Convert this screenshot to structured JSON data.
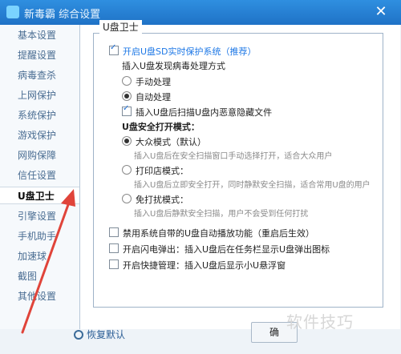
{
  "window": {
    "title": "新毒霸 综合设置",
    "close": "✕"
  },
  "sidebar": {
    "items": [
      {
        "label": "基本设置",
        "active": false
      },
      {
        "label": "提醒设置",
        "active": false
      },
      {
        "label": "病毒查杀",
        "active": false
      },
      {
        "label": "上网保护",
        "active": false
      },
      {
        "label": "系统保护",
        "active": false
      },
      {
        "label": "游戏保护",
        "active": false
      },
      {
        "label": "网购保障",
        "active": false
      },
      {
        "label": "信任设置",
        "active": false
      },
      {
        "label": "U盘卫士",
        "active": true
      },
      {
        "label": "引擎设置",
        "active": false
      },
      {
        "label": "手机助手",
        "active": false
      },
      {
        "label": "加速球",
        "active": false
      },
      {
        "label": "截图",
        "active": false
      },
      {
        "label": "其他设置",
        "active": false
      }
    ]
  },
  "main": {
    "group_title": "U盘卫士",
    "enable_sd": {
      "label": "开启U盘SD实时保护系统（推荐）",
      "checked": true
    },
    "virus_section_title": "插入U盘发现病毒处理方式",
    "manual": {
      "label": "手动处理",
      "checked": false
    },
    "auto": {
      "label": "自动处理",
      "checked": true
    },
    "scan_hidden": {
      "label": "插入U盘后扫描U盘内恶意隐藏文件",
      "checked": true
    },
    "safe_open_title": "U盘安全打开模式：",
    "mode_public": {
      "label": "大众模式（默认）",
      "desc": "插入U盘后在安全扫描窗口手动选择打开，适合大众用户",
      "checked": true
    },
    "mode_shop": {
      "label": "打印店模式：",
      "desc": "插入U盘后立即安全打开，同时静默安全扫描，适合常用U盘的用户",
      "checked": false
    },
    "mode_silent": {
      "label": "免打扰模式：",
      "desc": "插入U盘后静默安全扫描，用户不会受到任何打扰",
      "checked": false
    },
    "disable_autoplay": {
      "label": "禁用系统自带的U盘自动播放功能（重启后生效）",
      "checked": false
    },
    "flash_popup": {
      "label": "开启闪电弹出：插入U盘后在任务栏显示U盘弹出图标",
      "checked": false
    },
    "quick_manage": {
      "label": "开启快捷管理：插入U盘后显示小U悬浮窗",
      "checked": false
    }
  },
  "footer": {
    "restore_label": "恢复默认",
    "confirm_label": "确"
  },
  "watermark": "软件技巧",
  "colors": {
    "titlebar": "#1f72c6",
    "accent": "#1e78e6",
    "arrow": "#e0443a"
  }
}
